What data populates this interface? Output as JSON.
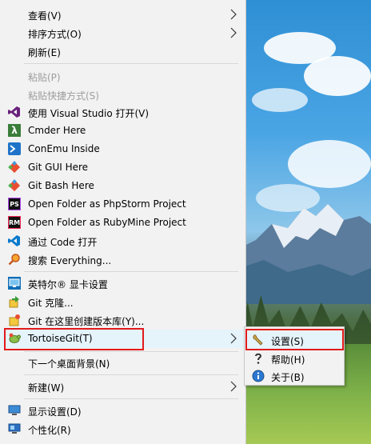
{
  "menu": {
    "items": [
      {
        "label": "查看(V)",
        "submenu": true
      },
      {
        "label": "排序方式(O)",
        "submenu": true
      },
      {
        "label": "刷新(E)"
      },
      {
        "label": "粘贴(P)",
        "disabled": true
      },
      {
        "label": "粘贴快捷方式(S)",
        "disabled": true
      },
      {
        "label": "使用 Visual Studio 打开(V)",
        "icon": "visual-studio-icon"
      },
      {
        "label": "Cmder Here",
        "icon": "cmder-lambda-icon"
      },
      {
        "label": "ConEmu Inside",
        "icon": "conemu-icon"
      },
      {
        "label": "Git GUI Here",
        "icon": "git-gui-icon"
      },
      {
        "label": "Git Bash Here",
        "icon": "git-bash-icon"
      },
      {
        "label": "Open Folder as PhpStorm Project",
        "icon": "phpstorm-icon"
      },
      {
        "label": "Open Folder as RubyMine Project",
        "icon": "rubymine-icon"
      },
      {
        "label": "通过 Code 打开",
        "icon": "vscode-icon"
      },
      {
        "label": "搜索 Everything...",
        "icon": "everything-search-icon"
      },
      {
        "label": "英特尔® 显卡设置",
        "icon": "intel-graphics-icon"
      },
      {
        "label": "Git 克隆...",
        "icon": "git-clone-icon"
      },
      {
        "label": "Git 在这里创建版本库(Y)...",
        "icon": "git-create-repo-icon"
      },
      {
        "label": "TortoiseGit(T)",
        "icon": "tortoisegit-icon",
        "submenu": true
      },
      {
        "label": "下一个桌面背景(N)"
      },
      {
        "label": "新建(W)",
        "submenu": true
      },
      {
        "label": "显示设置(D)",
        "icon": "display-settings-icon"
      },
      {
        "label": "个性化(R)",
        "icon": "personalize-icon"
      }
    ]
  },
  "tortoisegit_submenu": {
    "items": [
      {
        "label": "设置(S)",
        "icon": "settings-wrench-icon"
      },
      {
        "label": "帮助(H)",
        "icon": "help-icon"
      },
      {
        "label": "关于(B)",
        "icon": "about-info-icon"
      }
    ]
  },
  "colors": {
    "menu_bg": "#f2f2f2",
    "highlight": "#e5f3fb",
    "annotation_box": "#e21b1b",
    "disabled_text": "#9d9d9d"
  }
}
